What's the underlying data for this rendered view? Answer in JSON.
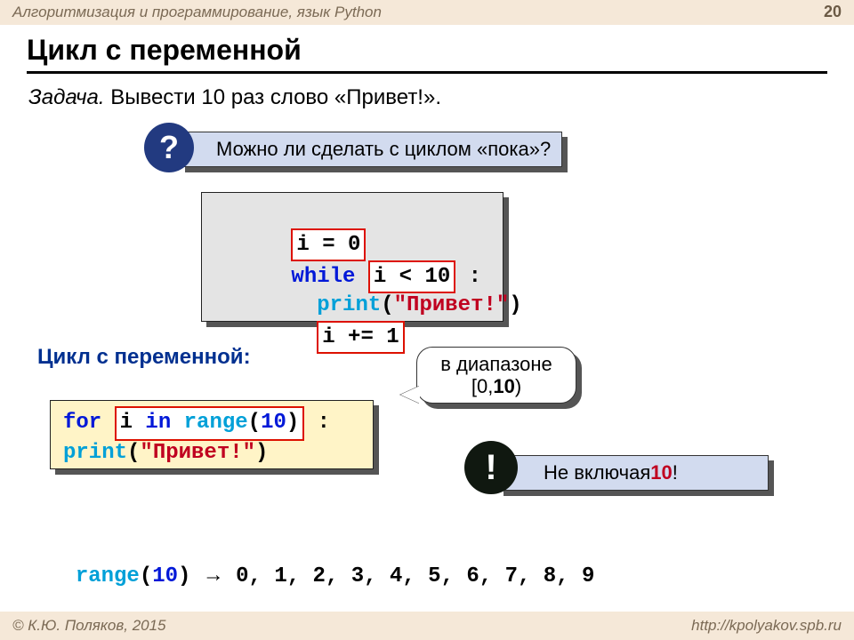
{
  "header": {
    "course": "Алгоритмизация и программирование, язык Python",
    "page": "20"
  },
  "title": "Цикл с переменной",
  "task_prefix": "Задача.",
  "task_body": " Вывести 10 раз слово «Привет!».",
  "question": {
    "badge": "?",
    "text": "Можно ли сделать с циклом «пока»?"
  },
  "code_while": {
    "l1_box": "i = 0",
    "l2_kw": "while ",
    "l2_box": "i < 10",
    "l2_tail": " :",
    "l3_indent": "  ",
    "l3_fn": "print",
    "l3_paren_open": "(",
    "l3_str": "\"Привет!\"",
    "l3_paren_close": ")",
    "l4_indent": "  ",
    "l4_box": "i += 1"
  },
  "for_heading": "Цикл с переменной:",
  "range_bubble": {
    "line1": "в диапазоне",
    "line2_a": "[0,",
    "line2_b": "10",
    "line2_c": ")"
  },
  "code_for": {
    "l1_kw": "for ",
    "l1_box_a": "i ",
    "l1_box_in": "in",
    "l1_box_b": " range",
    "l1_box_paren": "(",
    "l1_box_num": "10",
    "l1_box_close": ")",
    "l1_tail": " :",
    "l2_indent": "  ",
    "l2_fn": "print",
    "l2_paren_open": "(",
    "l2_str": "\"Привет!\"",
    "l2_paren_close": ")"
  },
  "excl": {
    "badge": "!",
    "text_a": "Не включая ",
    "text_b": "10",
    "text_c": "!"
  },
  "range_line": {
    "a": "range",
    "b": "(",
    "c": "10",
    "d": ")",
    "arrow": "  →  ",
    "rest": "0, 1, 2, 3, 4, 5, 6, 7, 8, 9"
  },
  "footer": {
    "left": "© К.Ю. Поляков, 2015",
    "right": "http://kpolyakov.spb.ru"
  }
}
